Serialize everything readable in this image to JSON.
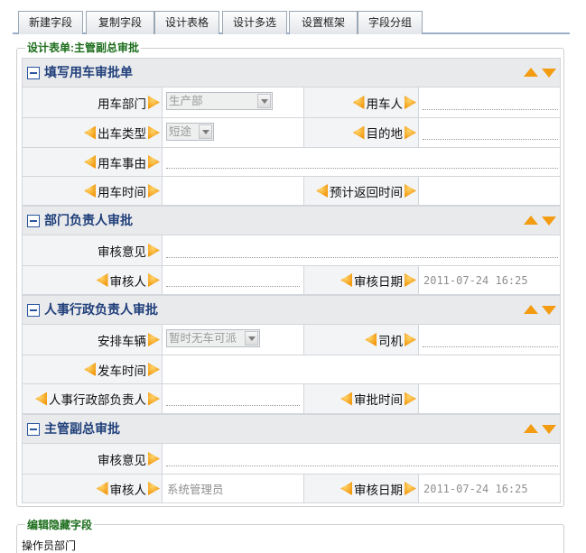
{
  "toolbar": {
    "tabs": [
      {
        "label": "新建字段"
      },
      {
        "label": "复制字段"
      },
      {
        "label": "设计表格"
      },
      {
        "label": "设计多选"
      },
      {
        "label": "设置框架"
      },
      {
        "label": "字段分组"
      }
    ]
  },
  "form": {
    "legend": "设计表单:主管副总审批",
    "sections": [
      {
        "title": "填写用车审批单",
        "fields": {
          "dept_label": "用车部门",
          "dept_value": "生产部",
          "user_label": "用车人",
          "trip_type_label": "出车类型",
          "trip_type_value": "短途",
          "destination_label": "目的地",
          "reason_label": "用车事由",
          "time_label": "用车时间",
          "return_label": "预计返回时间"
        }
      },
      {
        "title": "部门负责人审批",
        "fields": {
          "opinion_label": "审核意见",
          "reviewer_label": "审核人",
          "date_label": "审核日期",
          "date_value": "2011-07-24 16:25"
        }
      },
      {
        "title": "人事行政负责人审批",
        "fields": {
          "vehicle_label": "安排车辆",
          "vehicle_value": "暂时无车可派",
          "driver_label": "司机",
          "depart_label": "发车时间",
          "hr_head_label": "人事行政部负责人",
          "approve_time_label": "审批时间"
        }
      },
      {
        "title": "主管副总审批",
        "fields": {
          "opinion_label": "审核意见",
          "reviewer_label": "审核人",
          "reviewer_value": "系统管理员",
          "date_label": "审核日期",
          "date_value": "2011-07-24 16:25"
        }
      }
    ]
  },
  "hidden": {
    "legend": "编辑隐藏字段",
    "fields": [
      "操作员部门"
    ]
  },
  "colors": {
    "accent_arrow": "#f39c12",
    "legend_green": "#1c6d1c",
    "section_title": "#1f3f7a"
  }
}
